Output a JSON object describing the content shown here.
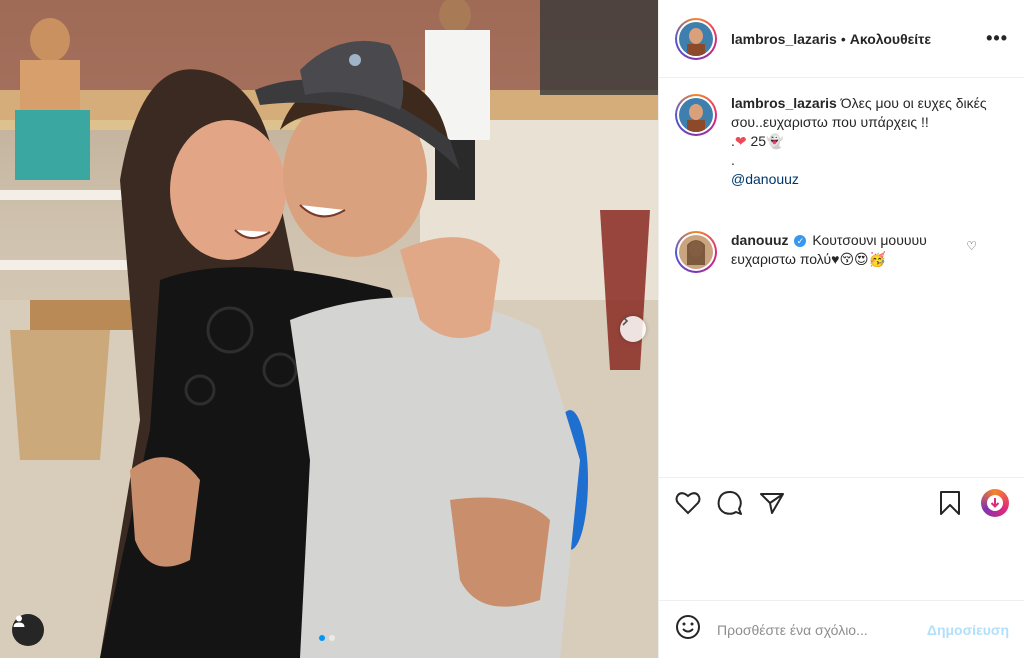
{
  "post": {
    "author": "lambros_lazaris",
    "separator": "•",
    "follow_status": "Ακολουθείτε",
    "more_label": "•••",
    "caption": {
      "username": "lambros_lazaris",
      "text_line1": " Όλες μου οι ευχες δικές σου..ευχαριστω που υπάρχεις !!",
      "text_line2_prefix": ".",
      "heart_emoji": "❤",
      "heart_count_text": "25",
      "ghost_emoji": "👻",
      "dot_line": ".",
      "mention": "@danouuz"
    },
    "comments": [
      {
        "username": "danouuz",
        "verified_mark": "✓",
        "text": " Κουτσουνι μουυυυ ευχαριστω πολύ",
        "emojis": "♥😚😍🥳"
      }
    ]
  },
  "composer": {
    "placeholder": "Προσθέστε ένα σχόλιο...",
    "post_label": "Δημοσίευση"
  },
  "icons": {
    "like": "heart-icon",
    "comment": "comment-icon",
    "share": "share-icon",
    "save": "bookmark-icon",
    "emoji": "smiley-icon",
    "next": "chevron-right-icon",
    "tagged": "user-icon"
  },
  "colors": {
    "accent": "#0095f6",
    "post_disabled": "#b2dffc",
    "text": "#262626"
  },
  "carousel": {
    "slides_total": 2,
    "current": 1
  }
}
